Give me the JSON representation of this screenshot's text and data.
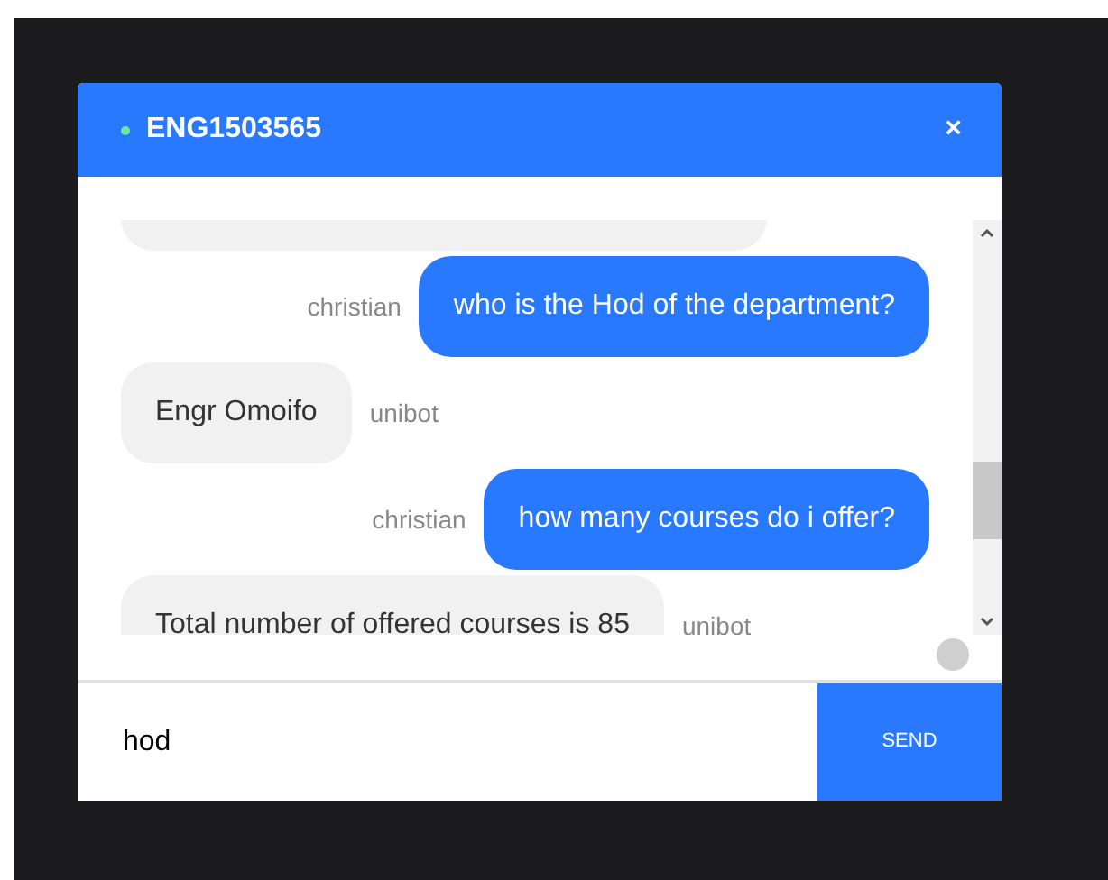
{
  "chat": {
    "title": "ENG1503565",
    "online": true,
    "close": "×"
  },
  "messages": [
    {
      "kind": "bot"
    },
    {
      "kind": "user",
      "sender": "christian",
      "text": "who is the Hod of the department?"
    },
    {
      "kind": "bot",
      "sender": "unibot",
      "text": "Engr Omoifo"
    },
    {
      "kind": "user",
      "sender": "christian",
      "text": "how many courses do i offer?"
    },
    {
      "kind": "bot",
      "sender": "unibot",
      "text": "Total number of offered courses is 85"
    }
  ],
  "input": {
    "value": "hod"
  },
  "send": "SEND"
}
